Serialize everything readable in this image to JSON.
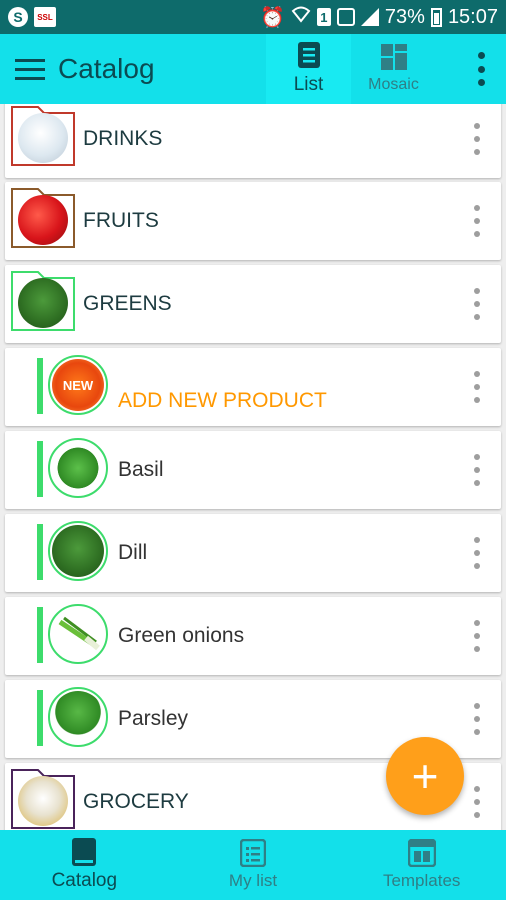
{
  "status_bar": {
    "battery": "73%",
    "time": "15:07",
    "sim": "1",
    "ssl_badge": "SSL"
  },
  "app_bar": {
    "title": "Catalog",
    "view_tabs": [
      {
        "label": "List",
        "active": true
      },
      {
        "label": "Mosaic",
        "active": false
      }
    ]
  },
  "list": {
    "rows": [
      {
        "kind": "category",
        "label": "DRINKS",
        "icon": "drinks-icon",
        "folder_color": "#c0392b"
      },
      {
        "kind": "category",
        "label": "FRUITS",
        "icon": "apple-icon",
        "folder_color": "#8b5a2b"
      },
      {
        "kind": "category",
        "label": "GREENS",
        "icon": "dill-icon",
        "folder_color": "#3ddc6c"
      },
      {
        "kind": "add_new",
        "label": "ADD NEW PRODUCT",
        "icon": "new-badge-icon"
      },
      {
        "kind": "product",
        "label": "Basil",
        "icon": "basil-icon"
      },
      {
        "kind": "product",
        "label": "Dill",
        "icon": "dill-icon"
      },
      {
        "kind": "product",
        "label": "Green onions",
        "icon": "green-onion-icon"
      },
      {
        "kind": "product",
        "label": "Parsley",
        "icon": "parsley-icon"
      },
      {
        "kind": "category",
        "label": "GROCERY",
        "icon": "grocery-icon",
        "folder_color": "#4a235a"
      }
    ]
  },
  "fab": {
    "symbol": "+"
  },
  "bottom_nav": {
    "items": [
      {
        "label": "Catalog",
        "active": true
      },
      {
        "label": "My list",
        "active": false
      },
      {
        "label": "Templates",
        "active": false
      }
    ]
  },
  "colors": {
    "accent": "#13e0ea",
    "status_bar": "#0e6b6b",
    "fab": "#ff9f1a",
    "new_product_text": "#ff9800",
    "product_bar": "#3ddc6c"
  }
}
